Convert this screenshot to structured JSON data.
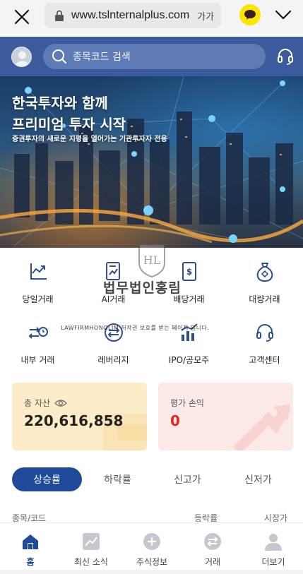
{
  "browser": {
    "url": "www.tslnternalplus.com",
    "text_size_label": "가가",
    "icons": [
      "close-icon",
      "lock-icon",
      "kakao-chat-icon",
      "chevron-down-icon"
    ]
  },
  "header": {
    "search_placeholder": "종목코드 검색",
    "icons": [
      "avatar-icon",
      "search-icon",
      "headset-icon"
    ]
  },
  "banner": {
    "title_line1": "한국투자와 함께",
    "title_line2": "프리미엄 투자 시작",
    "subtitle": "증권투자의 새로운 지평을 열어가는 기관투자자 전용"
  },
  "menu": {
    "items": [
      {
        "label": "당일거래",
        "icon": "chart-up-icon"
      },
      {
        "label": "AI거래",
        "icon": "document-chart-icon"
      },
      {
        "label": "배당거래",
        "icon": "dividend-document-icon"
      },
      {
        "label": "대량거래",
        "icon": "money-bag-icon"
      },
      {
        "label": "내부 거래",
        "icon": "exchange-clock-icon"
      },
      {
        "label": "레버리지",
        "icon": "refresh-arrows-icon"
      },
      {
        "label": "IPO/공모주",
        "icon": "bar-chart-icon"
      },
      {
        "label": "고객센터",
        "icon": "headset-icon"
      }
    ]
  },
  "watermark": {
    "logo_text": "HL",
    "title": "법무법인홍림",
    "line": "LAWFIRMHONGLIM 저작권 보호를 받는 페이지 입니다."
  },
  "cards": {
    "total_assets_label": "총 자산",
    "total_assets_value": "220,616,858",
    "pl_label": "평가 손익",
    "pl_value": "0"
  },
  "tabs": {
    "items": [
      "상승률",
      "하락률",
      "신고가",
      "신저가"
    ],
    "active_index": 0
  },
  "table_headers": {
    "col1": "종목/코드",
    "col2": "등락률",
    "col3": "시장가"
  },
  "bottom_nav": {
    "items": [
      {
        "label": "홈",
        "icon": "home-icon"
      },
      {
        "label": "최신 소식",
        "icon": "chart-news-icon"
      },
      {
        "label": "주식정보",
        "icon": "plus-circle-icon"
      },
      {
        "label": "거래",
        "icon": "swap-icon"
      },
      {
        "label": "더보기",
        "icon": "person-icon"
      }
    ],
    "active_index": 0
  },
  "colors": {
    "header_blue": "#3c5a9e",
    "tab_active": "#1f4a99",
    "asset_card": "#fcecc8",
    "pl_card": "#fbe9e8",
    "pl_value": "#e32525",
    "icon_blue": "#2d4f8e"
  }
}
